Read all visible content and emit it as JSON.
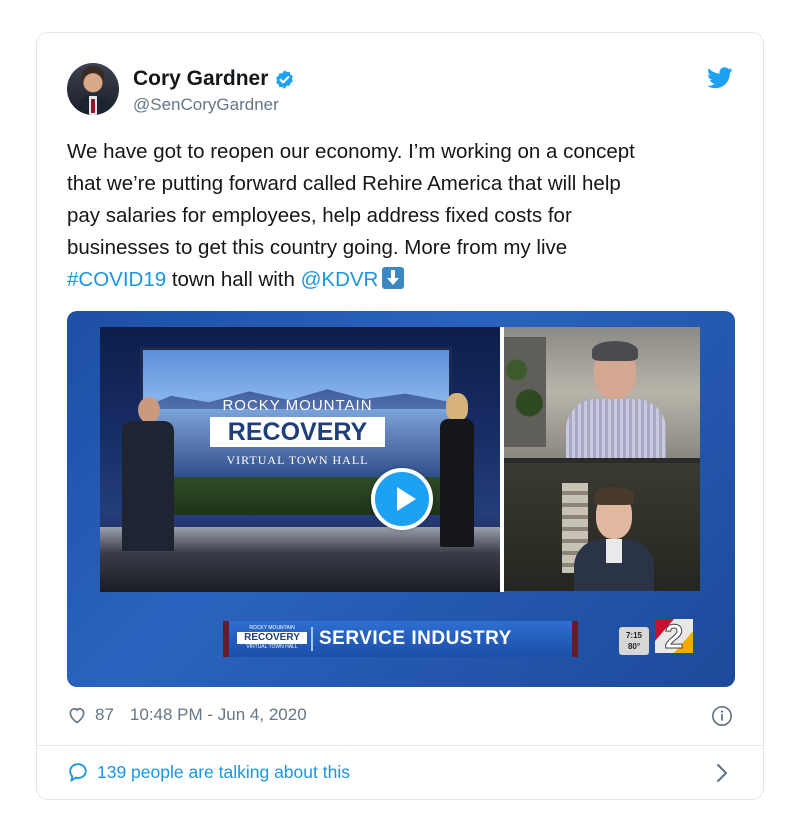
{
  "author": {
    "display_name": "Cory Gardner",
    "handle": "@SenCoryGardner"
  },
  "tweet": {
    "text_line_1": "We have got to reopen our economy. I’m working on a concept",
    "text_line_2": "that we’re putting forward called Rehire America that will help",
    "text_line_3": "pay salaries for employees, help address fixed costs for",
    "text_line_4": "businesses to get this country going. More from my live",
    "hashtag": "#COVID19",
    "mid_text": " town hall with ",
    "mention": "@KDVR"
  },
  "video": {
    "screen_title_top": "ROCKY MOUNTAIN",
    "screen_title_main": "RECOVERY",
    "screen_title_sub": "VIRTUAL TOWN HALL",
    "lower_third_logo_top": "ROCKY MOUNTAIN",
    "lower_third_logo_main": "RECOVERY",
    "lower_third_logo_sub": "VIRTUAL TOWN HALL",
    "lower_third_topic": "SERVICE INDUSTRY",
    "weather_time": "7:15",
    "weather_temp": "80°",
    "station_number": "2"
  },
  "footer": {
    "like_count": "87",
    "timestamp": "10:48 PM - Jun 4, 2020",
    "talking_text": "139 people are talking about this"
  },
  "colors": {
    "link": "#1b95e0",
    "verified": "#1da1f2",
    "secondary_text": "#657786"
  }
}
